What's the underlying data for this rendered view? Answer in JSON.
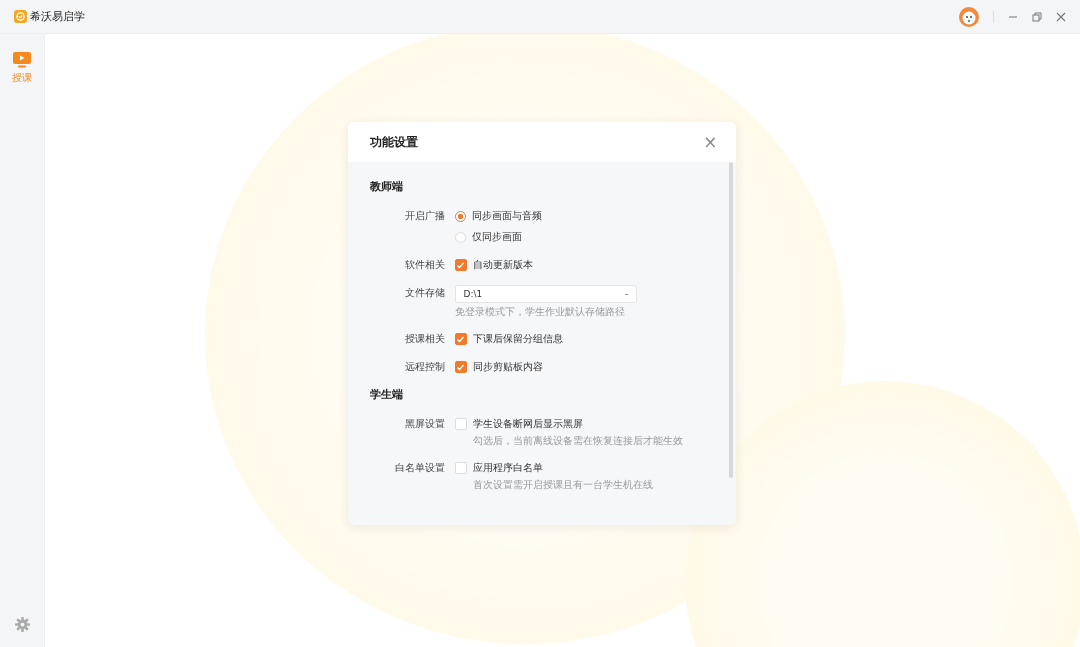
{
  "window": {
    "title": "希沃易启学"
  },
  "sidebar": {
    "items": [
      {
        "label": "授课",
        "selected": true
      }
    ]
  },
  "dialog": {
    "title": "功能设置",
    "close": "×",
    "sections": [
      {
        "title": "教师端",
        "rows": [
          {
            "label": "开启广播",
            "kind": "radio",
            "options": [
              {
                "text": "同步画面与音频",
                "selected": true
              },
              {
                "text": "仅同步画面",
                "selected": false
              }
            ]
          },
          {
            "label": "软件相关",
            "kind": "checkbox",
            "text": "自动更新版本",
            "checked": true
          },
          {
            "label": "文件存储",
            "kind": "select",
            "value": "D:\\1",
            "hint": "免登录模式下，学生作业默认存储路径"
          },
          {
            "label": "授课相关",
            "kind": "checkbox",
            "text": "下课后保留分组信息",
            "checked": true
          },
          {
            "label": "远程控制",
            "kind": "checkbox",
            "text": "同步剪贴板内容",
            "checked": true
          }
        ]
      },
      {
        "title": "学生端",
        "rows": [
          {
            "label": "黑屏设置",
            "kind": "checkbox",
            "text": "学生设备断网后显示黑屏",
            "checked": false,
            "hint": "勾选后，当前离线设备需在恢复连接后才能生效"
          },
          {
            "label": "白名单设置",
            "kind": "checkbox",
            "text": "应用程序白名单",
            "checked": false,
            "hint": "首次设置需开启授课且有一台学生机在线"
          }
        ]
      }
    ]
  }
}
